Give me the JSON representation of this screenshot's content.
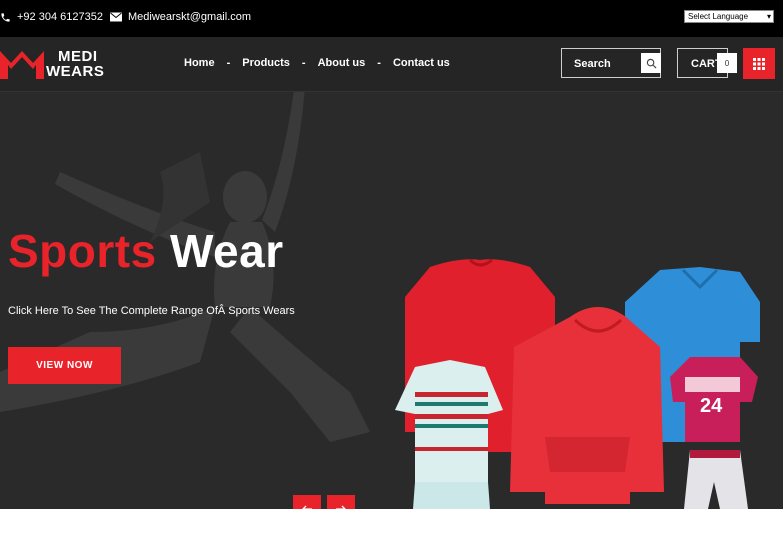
{
  "topbar": {
    "phone": "+92 304 6127352",
    "email": "Mediwearskt@gmail.com",
    "language_select": "Select Language"
  },
  "header": {
    "logo_line1": "MEDI",
    "logo_line2": "WEARS",
    "nav": [
      "Home",
      "Products",
      "About us",
      "Contact us"
    ],
    "nav_separator": "-",
    "search_placeholder": "Search",
    "cart_label": "CART",
    "cart_count": "0"
  },
  "hero": {
    "title_red": "Sports",
    "title_white": "Wear",
    "subtitle": "Click Here To See The Complete Range OfÂ  Sports Wears",
    "cta": "VIEW NOW"
  },
  "colors": {
    "accent": "#e8232a",
    "topbar_bg": "#000000",
    "header_bg": "#252525",
    "hero_bg": "#2a2a2b"
  },
  "icons": [
    "phone-icon",
    "envelope-icon",
    "search-icon",
    "grid-icon",
    "arrow-left-icon",
    "arrow-right-icon"
  ]
}
